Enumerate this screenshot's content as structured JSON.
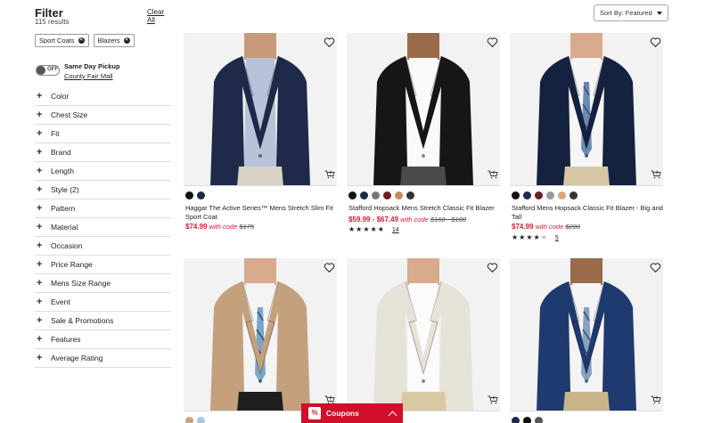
{
  "filter": {
    "title": "Filter",
    "result_count": "115 results",
    "clear_all": "Clear All",
    "chips": [
      {
        "label": "Sport Coats"
      },
      {
        "label": "Blazers"
      }
    ],
    "pickup": {
      "toggle_text": "OFF",
      "title": "Same Day Pickup",
      "store": "County Fair Mall"
    },
    "facets": [
      {
        "label": "Color"
      },
      {
        "label": "Chest Size"
      },
      {
        "label": "Fit"
      },
      {
        "label": "Brand"
      },
      {
        "label": "Length"
      },
      {
        "label": "Style (2)"
      },
      {
        "label": "Pattern"
      },
      {
        "label": "Material"
      },
      {
        "label": "Occasion"
      },
      {
        "label": "Price Range"
      },
      {
        "label": "Mens Size Range"
      },
      {
        "label": "Event"
      },
      {
        "label": "Sale & Promotions"
      },
      {
        "label": "Features"
      },
      {
        "label": "Average Rating"
      }
    ]
  },
  "sort": {
    "label": "Sort By: Featured"
  },
  "products": [
    {
      "name": "Haggar The Active Series™ Mens Stretch Slim Fit Sport Coat",
      "sale_price": "$74.99",
      "code_text": "with code",
      "original_price": "$175",
      "swatches": [
        "#111111",
        "#1c2a4a"
      ],
      "rating": null,
      "rating_count": ""
    },
    {
      "name": "Stafford Hopsack Mens Stretch Classic Fit Blazer",
      "sale_price": "$59.99 - $67.49",
      "code_text": "with code",
      "original_price": "$160 - $180",
      "swatches": [
        "#111111",
        "#1c2a4a",
        "#777777",
        "#6b1e22",
        "#c88a55",
        "#333333"
      ],
      "rating": 4.5,
      "rating_count": "14"
    },
    {
      "name": "Stafford Mens Hopsack Classic Fit Blazer - Big and Tall",
      "sale_price": "$74.99",
      "code_text": "with code",
      "original_price": "$200",
      "swatches": [
        "#111111",
        "#1c2a4a",
        "#6b1e22",
        "#9a9a9a",
        "#d8a875",
        "#333333"
      ],
      "rating": 4,
      "rating_count": "5"
    },
    {
      "name": "",
      "sale_price": "",
      "code_text": "",
      "original_price": "",
      "swatches": [
        "#c9a27a",
        "#a8c6e0"
      ],
      "rating": null,
      "rating_count": ""
    },
    {
      "name": "",
      "sale_price": "",
      "code_text": "",
      "original_price": "",
      "swatches": [],
      "rating": null,
      "rating_count": ""
    },
    {
      "name": "",
      "sale_price": "",
      "code_text": "",
      "original_price": "",
      "swatches": [
        "#1c2a4a",
        "#111111",
        "#555555"
      ],
      "rating": null,
      "rating_count": ""
    }
  ],
  "coupons": {
    "label": "Coupons",
    "icon": "%"
  },
  "colors": {
    "sale_red": "#e31837",
    "coupon_red": "#d0102a"
  }
}
